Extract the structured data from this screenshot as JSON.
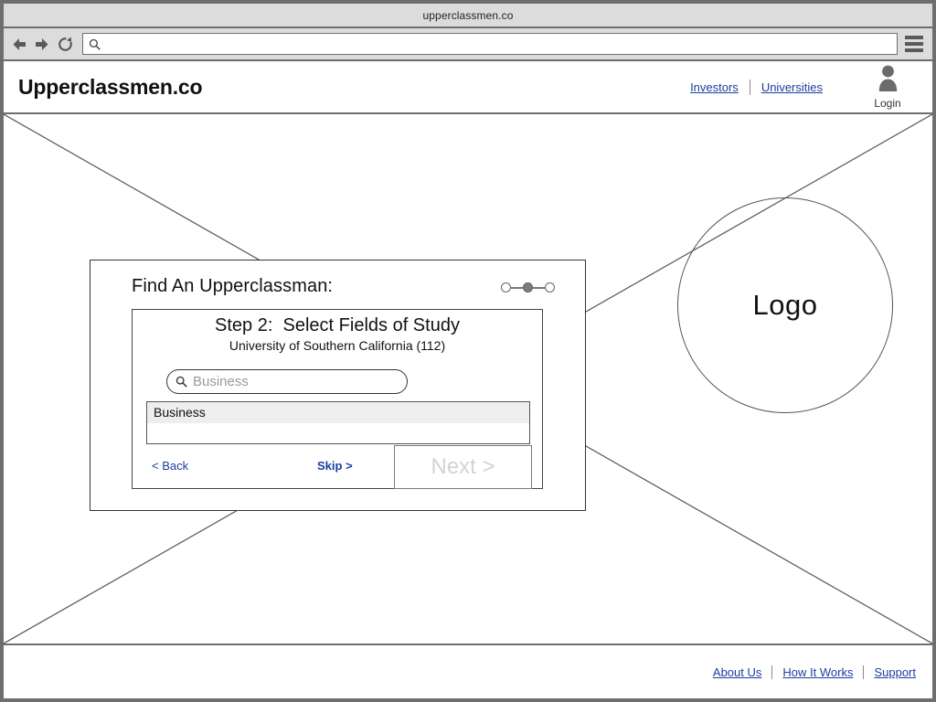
{
  "browser": {
    "title": "upperclassmen.co",
    "back_icon": "back-arrow-icon",
    "forward_icon": "forward-arrow-icon",
    "reload_icon": "reload-icon",
    "url_value": "",
    "url_placeholder": "",
    "url_search_icon": "search-icon",
    "menu_icon": "hamburger-menu-icon"
  },
  "header": {
    "brand": "Upperclassmen.co",
    "links": [
      {
        "label": "Investors"
      },
      {
        "label": "Universities"
      }
    ],
    "login": {
      "label": "Login",
      "icon": "user-avatar-icon"
    }
  },
  "hero": {
    "logo_text": "Logo",
    "placeholder_icon": "image-placeholder-diagonals"
  },
  "modal": {
    "title": "Find An Upperclassman:",
    "step_dots": [
      {
        "state": "inactive"
      },
      {
        "state": "active"
      },
      {
        "state": "inactive"
      }
    ],
    "step": {
      "heading": "Step 2:  Select Fields of Study",
      "subtitle": "University of Southern California (112)",
      "search": {
        "value": "Business",
        "placeholder": "Business",
        "icon": "search-icon"
      },
      "results": [
        {
          "label": "Business",
          "selected": true
        },
        {
          "label": "",
          "selected": false
        }
      ],
      "back_label": "< Back",
      "skip_label": "Skip >",
      "next_label": "Next >",
      "next_disabled": true
    }
  },
  "footer": {
    "links": [
      {
        "label": "About Us"
      },
      {
        "label": "How It Works"
      },
      {
        "label": "Support"
      }
    ]
  },
  "colors": {
    "chrome_bg": "#dcdcdc",
    "chrome_border": "#6e6e6e",
    "link_blue": "#1a3f9e",
    "selected_row": "#eeeeee",
    "disabled_text": "#d3d3d3",
    "dot_active": "#7d7d7d"
  }
}
